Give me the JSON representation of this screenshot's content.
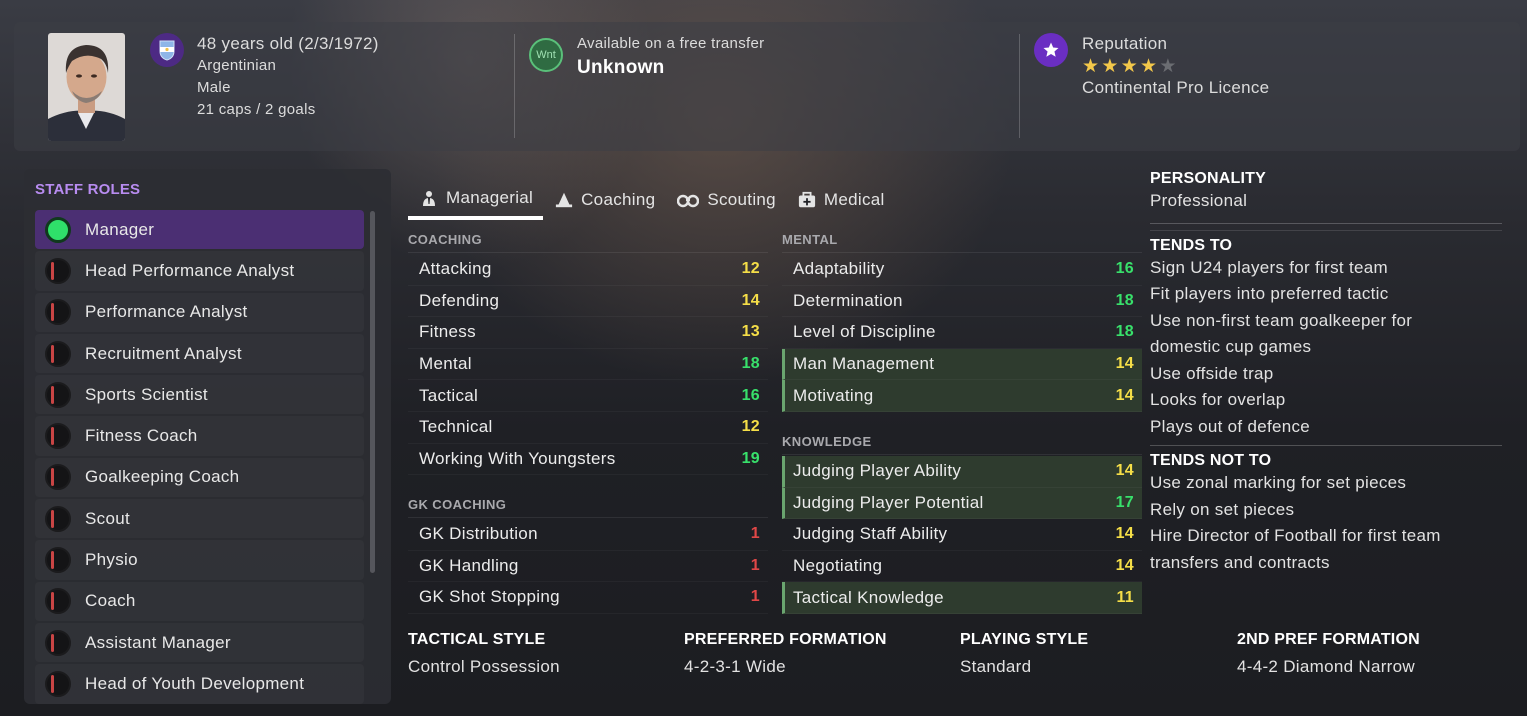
{
  "header": {
    "age": "48 years old (2/3/1972)",
    "nationality": "Argentinian",
    "gender": "Male",
    "caps": "21 caps / 2 goals",
    "wnt_label": "Wnt",
    "transfer_status": "Available on a free transfer",
    "contract": "Unknown",
    "reputation_label": "Reputation",
    "reputation_stars": 4,
    "reputation_max": 5,
    "licence": "Continental Pro Licence"
  },
  "staff_roles": {
    "title": "STAFF ROLES",
    "items": [
      {
        "label": "Manager",
        "active": true
      },
      {
        "label": "Head Performance Analyst",
        "active": false
      },
      {
        "label": "Performance Analyst",
        "active": false
      },
      {
        "label": "Recruitment Analyst",
        "active": false
      },
      {
        "label": "Sports Scientist",
        "active": false
      },
      {
        "label": "Fitness Coach",
        "active": false
      },
      {
        "label": "Goalkeeping Coach",
        "active": false
      },
      {
        "label": "Scout",
        "active": false
      },
      {
        "label": "Physio",
        "active": false
      },
      {
        "label": "Coach",
        "active": false
      },
      {
        "label": "Assistant Manager",
        "active": false
      },
      {
        "label": "Head of Youth Development",
        "active": false
      }
    ]
  },
  "tabs": [
    {
      "label": "Managerial",
      "icon": "managerial-icon",
      "active": true
    },
    {
      "label": "Coaching",
      "icon": "coaching-icon",
      "active": false
    },
    {
      "label": "Scouting",
      "icon": "binoculars-icon",
      "active": false
    },
    {
      "label": "Medical",
      "icon": "medical-kit-icon",
      "active": false
    }
  ],
  "colors": {
    "green": "#38e06b",
    "yellow": "#f5de48",
    "red": "#e04747",
    "accent_purple": "#b88cf0"
  },
  "coaching": {
    "title": "COACHING",
    "items": [
      {
        "label": "Attacking",
        "value": "12",
        "color": "yellow"
      },
      {
        "label": "Defending",
        "value": "14",
        "color": "yellow"
      },
      {
        "label": "Fitness",
        "value": "13",
        "color": "yellow"
      },
      {
        "label": "Mental",
        "value": "18",
        "color": "green"
      },
      {
        "label": "Tactical",
        "value": "16",
        "color": "green"
      },
      {
        "label": "Technical",
        "value": "12",
        "color": "yellow"
      },
      {
        "label": "Working With Youngsters",
        "value": "19",
        "color": "green"
      }
    ]
  },
  "gk_coaching": {
    "title": "GK COACHING",
    "items": [
      {
        "label": "GK Distribution",
        "value": "1",
        "color": "red"
      },
      {
        "label": "GK Handling",
        "value": "1",
        "color": "red"
      },
      {
        "label": "GK Shot Stopping",
        "value": "1",
        "color": "red"
      }
    ]
  },
  "mental": {
    "title": "MENTAL",
    "items": [
      {
        "label": "Adaptability",
        "value": "16",
        "color": "green",
        "hl": false
      },
      {
        "label": "Determination",
        "value": "18",
        "color": "green",
        "hl": false
      },
      {
        "label": "Level of Discipline",
        "value": "18",
        "color": "green",
        "hl": false
      },
      {
        "label": "Man Management",
        "value": "14",
        "color": "yellow",
        "hl": true
      },
      {
        "label": "Motivating",
        "value": "14",
        "color": "yellow",
        "hl": true
      }
    ]
  },
  "knowledge": {
    "title": "KNOWLEDGE",
    "items": [
      {
        "label": "Judging Player Ability",
        "value": "14",
        "color": "yellow",
        "hl": true
      },
      {
        "label": "Judging Player Potential",
        "value": "17",
        "color": "green",
        "hl": true
      },
      {
        "label": "Judging Staff Ability",
        "value": "14",
        "color": "yellow",
        "hl": false
      },
      {
        "label": "Negotiating",
        "value": "14",
        "color": "yellow",
        "hl": false
      },
      {
        "label": "Tactical Knowledge",
        "value": "11",
        "color": "yellow",
        "hl": true
      }
    ]
  },
  "personality": {
    "title": "PERSONALITY",
    "value": "Professional"
  },
  "tends_to": {
    "title": "TENDS TO",
    "items": [
      "Sign U24 players for first team",
      "Fit players into preferred tactic",
      "Use non-first team goalkeeper for",
      "domestic cup games",
      "Use offside trap",
      "Looks for overlap",
      "Plays out of defence"
    ]
  },
  "tends_not_to": {
    "title": "TENDS NOT TO",
    "items": [
      "Use zonal marking for set pieces",
      "Rely on set pieces",
      "Hire Director of Football for first team",
      "transfers and contracts"
    ]
  },
  "bottom": {
    "tactical_style_label": "TACTICAL STYLE",
    "tactical_style": "Control Possession",
    "preferred_formation_label": "PREFERRED FORMATION",
    "preferred_formation": "4-2-3-1 Wide",
    "playing_style_label": "PLAYING STYLE",
    "playing_style": "Standard",
    "second_formation_label": "2ND PREF FORMATION",
    "second_formation": "4-4-2 Diamond Narrow"
  }
}
